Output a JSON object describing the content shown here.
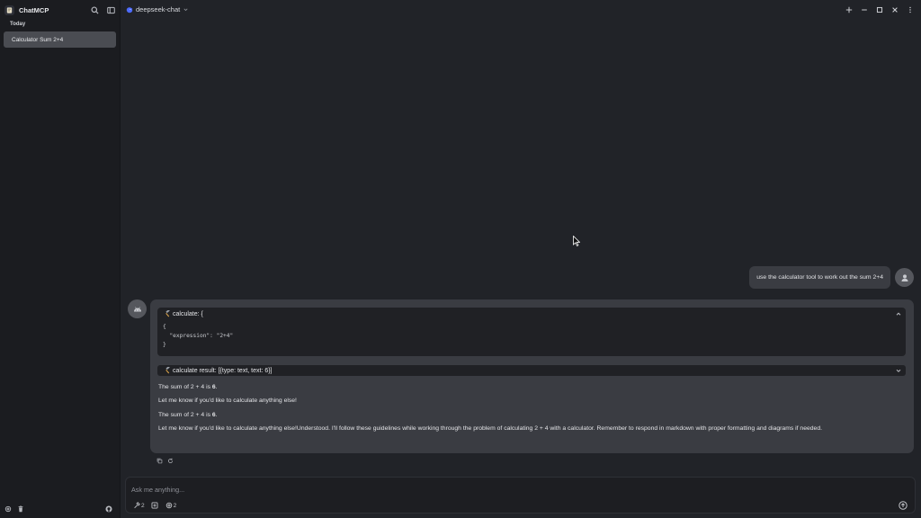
{
  "app": {
    "title": "ChatMCP"
  },
  "sidebar": {
    "section": "Today",
    "chats": [
      {
        "label": "Calculator Sum 2+4",
        "selected": true
      }
    ]
  },
  "topbar": {
    "model": "deepseek-chat"
  },
  "conversation": {
    "user_message": "use the calculator tool to work out the sum 2+4",
    "tool_call": {
      "header": "calculate: {",
      "code_lines": [
        "{",
        "  \"expression\": \"2+4\"",
        "}"
      ]
    },
    "tool_result": {
      "header": "calculate result: [{type: text, text: 6}]"
    },
    "reply": {
      "p1_prefix": "The sum of 2 + 4 is ",
      "p1_value": "6",
      "p1_suffix": ".",
      "p2": "Let me know if you'd like to calculate anything else!",
      "p3_prefix": "The sum of 2 + 4 is ",
      "p3_value": "6",
      "p3_suffix": ".",
      "p4": "Let me know if you'd like to calculate anything else!Understood. I'll follow these guidelines while working through the problem of calculating 2 + 4 with a calculator. Remember to respond in markdown with proper formatting and diagrams if needed."
    }
  },
  "composer": {
    "placeholder": "Ask me anything...",
    "tools_count": "2",
    "servers_count": "2"
  },
  "colors": {
    "background": "#212328",
    "sidebar": "#1b1c20",
    "bubble": "#3a3c42",
    "selected_item": "#4a4c52",
    "code_block": "#202125"
  }
}
